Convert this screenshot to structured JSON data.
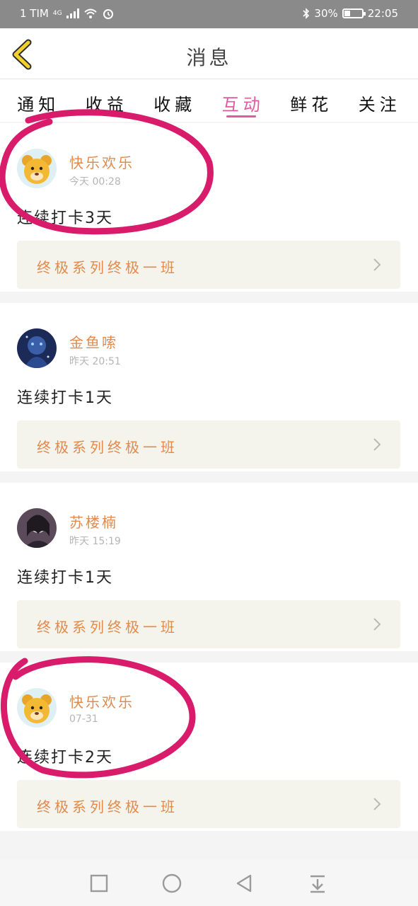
{
  "status_bar": {
    "carrier": "1 TIM",
    "network": "4G",
    "battery_text": "30%",
    "battery_level": 0.3,
    "time": "22:05",
    "icons": [
      "signal-icon",
      "wifi-icon",
      "alarm-icon",
      "bluetooth-icon",
      "battery-icon"
    ]
  },
  "header": {
    "title": "消息",
    "back_icon": "chevron-left-icon"
  },
  "tabs": [
    {
      "label": "通知",
      "active": false
    },
    {
      "label": "收益",
      "active": false
    },
    {
      "label": "收藏",
      "active": false
    },
    {
      "label": "互动",
      "active": true
    },
    {
      "label": "鲜花",
      "active": false
    },
    {
      "label": "关注",
      "active": false
    }
  ],
  "messages": [
    {
      "name": "快乐欢乐",
      "time": "今天 00:28",
      "text": "连续打卡3天",
      "course": "终极系列终极一班",
      "avatar": "bear-avatar",
      "highlighted": true
    },
    {
      "name": "金鱼嗦",
      "time": "昨天 20:51",
      "text": "连续打卡1天",
      "course": "终极系列终极一班",
      "avatar": "anime-avatar",
      "highlighted": false
    },
    {
      "name": "苏楼楠",
      "time": "昨天 15:19",
      "text": "连续打卡1天",
      "course": "终极系列终极一班",
      "avatar": "photo-avatar",
      "highlighted": false
    },
    {
      "name": "快乐欢乐",
      "time": "07-31",
      "text": "连续打卡2天",
      "course": "终极系列终极一班",
      "avatar": "bear-avatar",
      "highlighted": true
    }
  ],
  "colors": {
    "accent_pink": "#e05aa0",
    "name_orange": "#e08a4e",
    "annotation": "#d81b6a",
    "back_yellow": "#f1d12d"
  },
  "nav_bar": [
    "square-icon",
    "circle-icon",
    "triangle-back-icon",
    "pull-down-icon"
  ]
}
